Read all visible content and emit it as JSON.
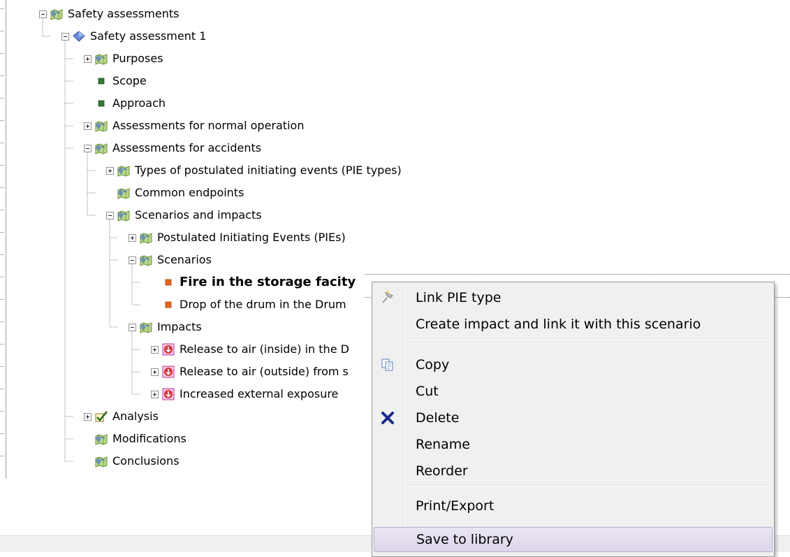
{
  "tree": {
    "nodes": [
      {
        "label": "Safety assessments",
        "icon": "folder-map-icon",
        "expander": "minus"
      },
      {
        "label": "Safety assessment 1",
        "icon": "blue-diamond-icon",
        "expander": "minus"
      },
      {
        "label": "Purposes",
        "icon": "folder-map-icon",
        "expander": "plus"
      },
      {
        "label": "Scope",
        "icon": "green-square-icon",
        "expander": "none"
      },
      {
        "label": "Approach",
        "icon": "green-square-icon",
        "expander": "none"
      },
      {
        "label": "Assessments for normal operation",
        "icon": "folder-map-icon",
        "expander": "plus"
      },
      {
        "label": "Assessments for accidents",
        "icon": "folder-map-icon",
        "expander": "minus"
      },
      {
        "label": "Types of postulated initiating events (PIE types)",
        "icon": "folder-map-icon",
        "expander": "plus"
      },
      {
        "label": "Common endpoints",
        "icon": "folder-map-icon",
        "expander": "none"
      },
      {
        "label": "Scenarios and impacts",
        "icon": "folder-map-icon",
        "expander": "minus"
      },
      {
        "label": "Postulated Initiating Events (PIEs)",
        "icon": "folder-map-icon",
        "expander": "plus"
      },
      {
        "label": "Scenarios",
        "icon": "folder-map-icon",
        "expander": "minus"
      },
      {
        "label": "Fire in the storage facity",
        "icon": "orange-square-icon",
        "expander": "none",
        "selected": true
      },
      {
        "label": "Drop of the drum in the Drum",
        "icon": "orange-square-icon",
        "expander": "none"
      },
      {
        "label": "Impacts",
        "icon": "folder-map-icon",
        "expander": "minus"
      },
      {
        "label": "Release to air (inside) in the D",
        "icon": "red-down-arrow-icon",
        "expander": "plus"
      },
      {
        "label": "Release to air (outside) from s",
        "icon": "red-down-arrow-icon",
        "expander": "plus"
      },
      {
        "label": "Increased external exposure",
        "icon": "red-down-arrow-icon",
        "expander": "plus"
      },
      {
        "label": "Analysis",
        "icon": "checkmark-icon",
        "expander": "plus"
      },
      {
        "label": "Modifications",
        "icon": "folder-map-icon",
        "expander": "none"
      },
      {
        "label": "Conclusions",
        "icon": "folder-map-icon",
        "expander": "none"
      }
    ]
  },
  "context_menu": {
    "items": [
      {
        "label": "Link PIE type",
        "icon": "link-pin-icon"
      },
      {
        "label": "Create impact and link it with this scenario",
        "icon": ""
      },
      {
        "label": "Copy",
        "icon": "copy-icon"
      },
      {
        "label": "Cut",
        "icon": ""
      },
      {
        "label": "Delete",
        "icon": "delete-x-icon"
      },
      {
        "label": "Rename",
        "icon": ""
      },
      {
        "label": "Reorder",
        "icon": ""
      },
      {
        "label": "Print/Export",
        "icon": ""
      },
      {
        "label": "Save to library",
        "icon": "",
        "highlighted": true
      }
    ]
  },
  "colors": {
    "menu_background": "#f0f0f0",
    "menu_highlight": "#e3deee",
    "folder_green": "#a8cf5a",
    "scope_green": "#2e7d32",
    "scenario_orange": "#e8661c",
    "impact_red": "#d6333a",
    "delete_blue": "#1b2a8a"
  }
}
